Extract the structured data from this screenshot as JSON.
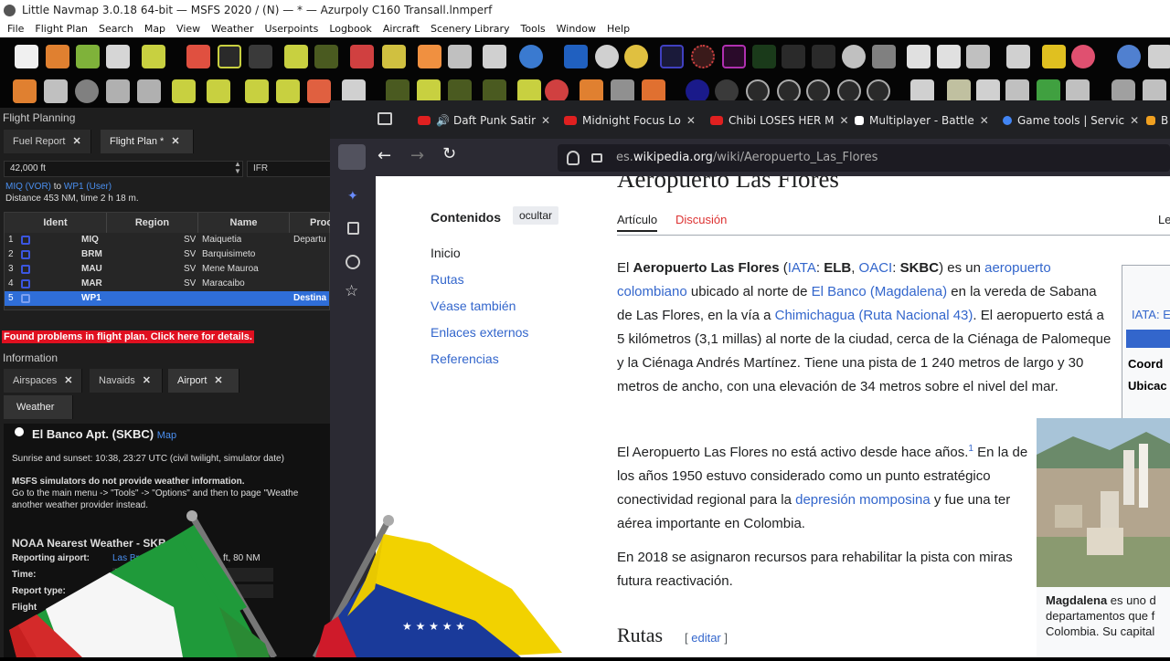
{
  "window": {
    "title": "Little Navmap 3.0.18 64-bit — MSFS 2020 / (N) — * — Azurpoly C160 Transall.lnmperf"
  },
  "menu": [
    "File",
    "Flight Plan",
    "Search",
    "Map",
    "View",
    "Weather",
    "Userpoints",
    "Logbook",
    "Aircraft",
    "Scenery Library",
    "Tools",
    "Window",
    "Help"
  ],
  "left": {
    "flight_planning_title": "Flight Planning",
    "tabs": [
      {
        "label": "Fuel Report"
      },
      {
        "label": "Flight Plan *"
      }
    ],
    "altitude": "42,000 ft",
    "rules": "IFR",
    "route": {
      "from": "MIQ (VOR)",
      "to_word": " to ",
      "to": "WP1 (User)",
      "distance": "Distance 453 NM, time 2 h 18 m."
    },
    "columns": [
      "Ident",
      "Region",
      "Name",
      "Proc"
    ],
    "rows": [
      {
        "n": "1",
        "ident": "MIQ",
        "region": "SV",
        "name": "Maiquetia",
        "proc": "Departu"
      },
      {
        "n": "2",
        "ident": "BRM",
        "region": "SV",
        "name": "Barquisimeto",
        "proc": ""
      },
      {
        "n": "3",
        "ident": "MAU",
        "region": "SV",
        "name": "Mene Mauroa",
        "proc": ""
      },
      {
        "n": "4",
        "ident": "MAR",
        "region": "SV",
        "name": "Maracaibo",
        "proc": ""
      },
      {
        "n": "5",
        "ident": "WP1",
        "region": "",
        "name": "",
        "proc": "Destina"
      }
    ],
    "problem": "Found problems in flight plan. Click here for details.",
    "information_title": "Information",
    "info_tabs": [
      {
        "label": "Airspaces"
      },
      {
        "label": "Navaids"
      },
      {
        "label": "Airport"
      }
    ],
    "weather_tab": "Weather",
    "airport": {
      "name": "El Banco Apt. (SKBC)",
      "map_link": "Map",
      "sun": "Sunrise and sunset: 10:38, 23:27 UTC (civil twilight, simulator date)",
      "msfs_note": "MSFS simulators do not provide weather information.",
      "msfs_note2": "Go to the main menu -> \"Tools\" -> \"Options\" and then to page \"Weathe",
      "msfs_note3": "another weather provider instead.",
      "noaa_title": "NOAA Nearest Weather - SKB",
      "reporting_label": "Reporting airport:",
      "reporting_value": "Las Br",
      "reporting_extra": "ft, 80 NM",
      "time_label": "Time:",
      "time_value": "22",
      "report_type_label": "Report type:",
      "flight_label": "Flight"
    }
  },
  "browser": {
    "tabs": [
      {
        "label": "Daft Punk Satir",
        "color": "#e02020"
      },
      {
        "label": "Midnight Focus Lo",
        "color": "#e02020"
      },
      {
        "label": "Chibi LOSES HER M",
        "color": "#e02020"
      },
      {
        "label": "Multiplayer - Battle",
        "color": "#ffffff"
      },
      {
        "label": "Game tools | Servic",
        "color": "#4285f4"
      },
      {
        "label": "B",
        "color": "#f0a020"
      }
    ],
    "url_domain_pre": "es.",
    "url_domain": "wikipedia.org",
    "url_path": "/wiki/Aeropuerto_Las_Flores"
  },
  "wiki": {
    "title": "Aeropuerto Las Flores",
    "toc_title": "Contenidos",
    "toc_hide": "ocultar",
    "toc": [
      "Inicio",
      "Rutas",
      "Véase también",
      "Enlaces externos",
      "Referencias"
    ],
    "tab_article": "Artículo",
    "tab_discussion": "Discusión",
    "tab_right": "Le",
    "p1": {
      "t1": "El ",
      "b1": "Aeropuerto Las Flores",
      "t2": " (",
      "l1": "IATA",
      "t3": ": ",
      "b2": "ELB",
      "t4": ", ",
      "l2": "OACI",
      "t5": ": ",
      "b3": "SKBC",
      "t6": ") es un ",
      "l3": "aeropuerto colombiano",
      "t7": " ubicado al norte de ",
      "l4": "El Banco (Magdalena)",
      "t8": " en la vereda de Sabana de Las Flores, en la vía a ",
      "l5": "Chimichagua (Ruta Nacional 43)",
      "t9": ". El aeropuerto está a 5 kilómetros (3,1 millas) al norte de la ciudad, cerca de la Ciénaga de Palomeque y la Ciénaga Andrés Martínez. Tiene una pista de 1 240 metros de largo y 30 metros de ancho, con una elevación de 34 metros sobre el nivel del mar."
    },
    "p2": {
      "t1": "El Aeropuerto Las Flores no está activo desde hace años.",
      "sup": "1",
      "t2": " En la de los años 1950 estuvo considerado como un punto estratégico conectividad regional para la ",
      "l1": "depresión momposina",
      "t3": " y fue una ter aérea importante en Colombia."
    },
    "p3": "En 2018 se asignaron recursos para rehabilitar la pista con miras futura reactivación.",
    "h2": "Rutas",
    "edit": "editar",
    "infobox": [
      "IATA: E",
      "Coord",
      "Ubicac"
    ],
    "caption_bold": "Magdalena",
    "caption_rest": " es uno d departamentos que f Colombia. Su capital"
  }
}
